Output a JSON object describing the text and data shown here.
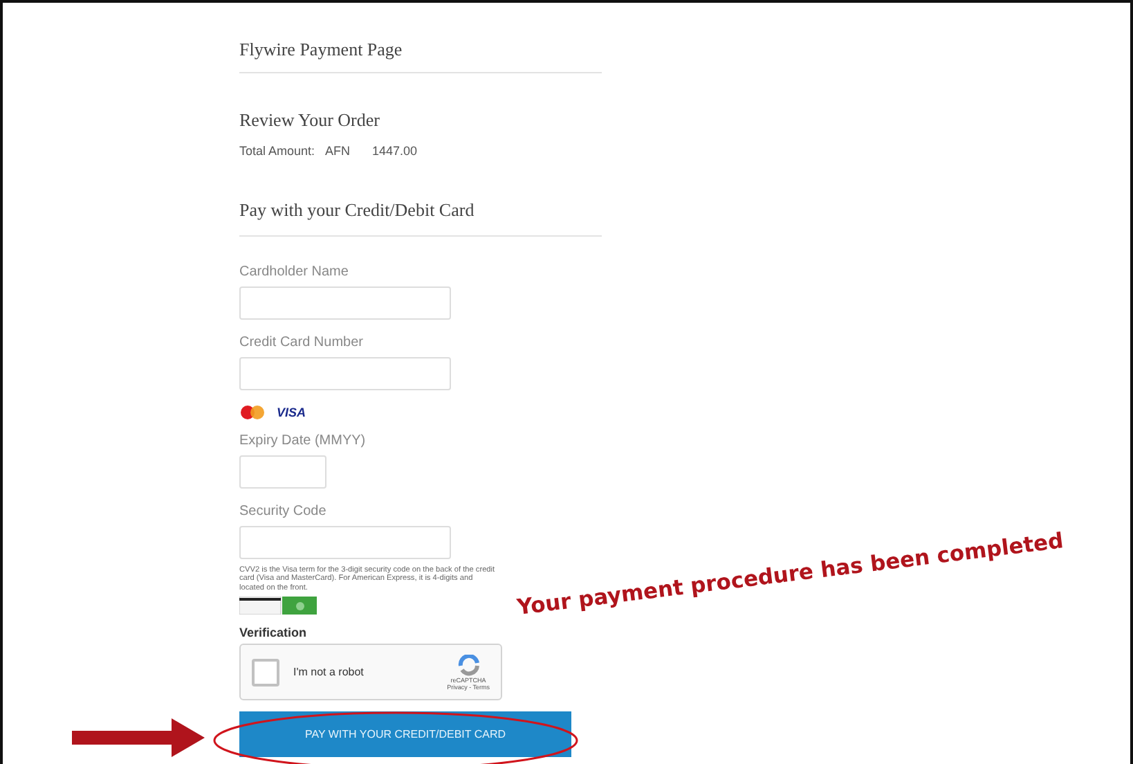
{
  "page_title": "Flywire Payment Page",
  "order": {
    "heading": "Review Your Order",
    "total_label": "Total Amount:",
    "currency": "AFN",
    "amount": "1447.00"
  },
  "card_section": {
    "heading": "Pay with your Credit/Debit Card",
    "fields": [
      {
        "label": "Cardholder Name",
        "kind": "wide"
      },
      {
        "label": "Credit Card Number",
        "kind": "wide"
      },
      {
        "label": "Expiry Date (MMYY)",
        "kind": "narrow"
      },
      {
        "label": "Security Code",
        "kind": "wide"
      }
    ],
    "card_brands": [
      {
        "kind": "mastercard"
      },
      {
        "kind": "visa",
        "text": "VISA"
      }
    ],
    "cvv_note": "CVV2 is the Visa term for the 3-digit security code on the back of the credit card (Visa and MasterCard). For American Express, it is 4-digits and located on the front."
  },
  "verification": {
    "label": "Verification",
    "checkbox_text": "I'm not a robot",
    "checked": false,
    "brand": "reCAPTCHA",
    "links": "Privacy - Terms"
  },
  "pay_button": "PAY WITH YOUR CREDIT/DEBIT CARD",
  "annotation": {
    "text": "Your payment procedure has been completed"
  }
}
